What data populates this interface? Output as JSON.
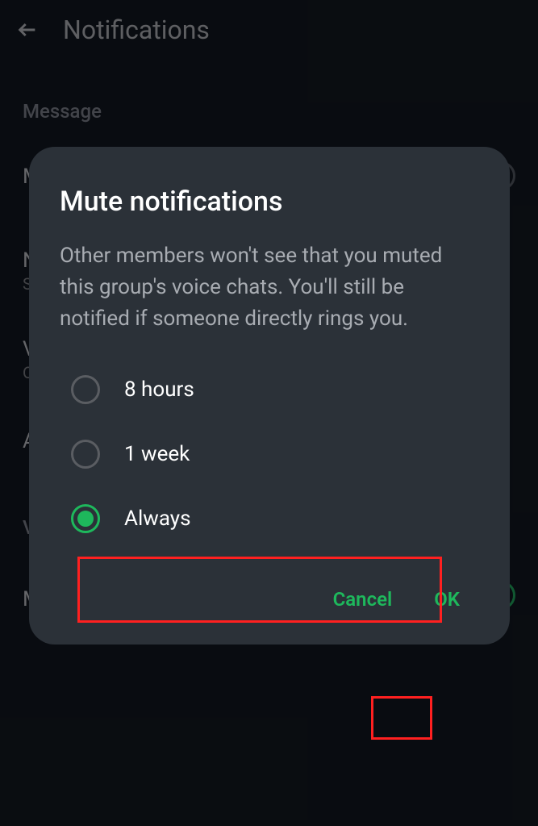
{
  "header": {
    "title": "Notifications"
  },
  "background": {
    "section1_heading": "Message",
    "row1_label": "M",
    "row2_label": "No",
    "row2_sublabel": "Sil",
    "row3_label": "Vil",
    "row3_sublabel": "Of",
    "row4_label": "Ad",
    "section2_heading": "Vo",
    "row5_label": "Mu"
  },
  "dialog": {
    "title": "Mute notifications",
    "body": "Other members won't see that you muted this group's voice chats. You'll still be notified if someone directly rings you.",
    "options": [
      {
        "label": "8 hours",
        "selected": false
      },
      {
        "label": "1 week",
        "selected": false
      },
      {
        "label": "Always",
        "selected": true
      }
    ],
    "cancel_label": "Cancel",
    "ok_label": "OK"
  },
  "colors": {
    "accent": "#1eb85c",
    "highlight": "#ff2020"
  }
}
